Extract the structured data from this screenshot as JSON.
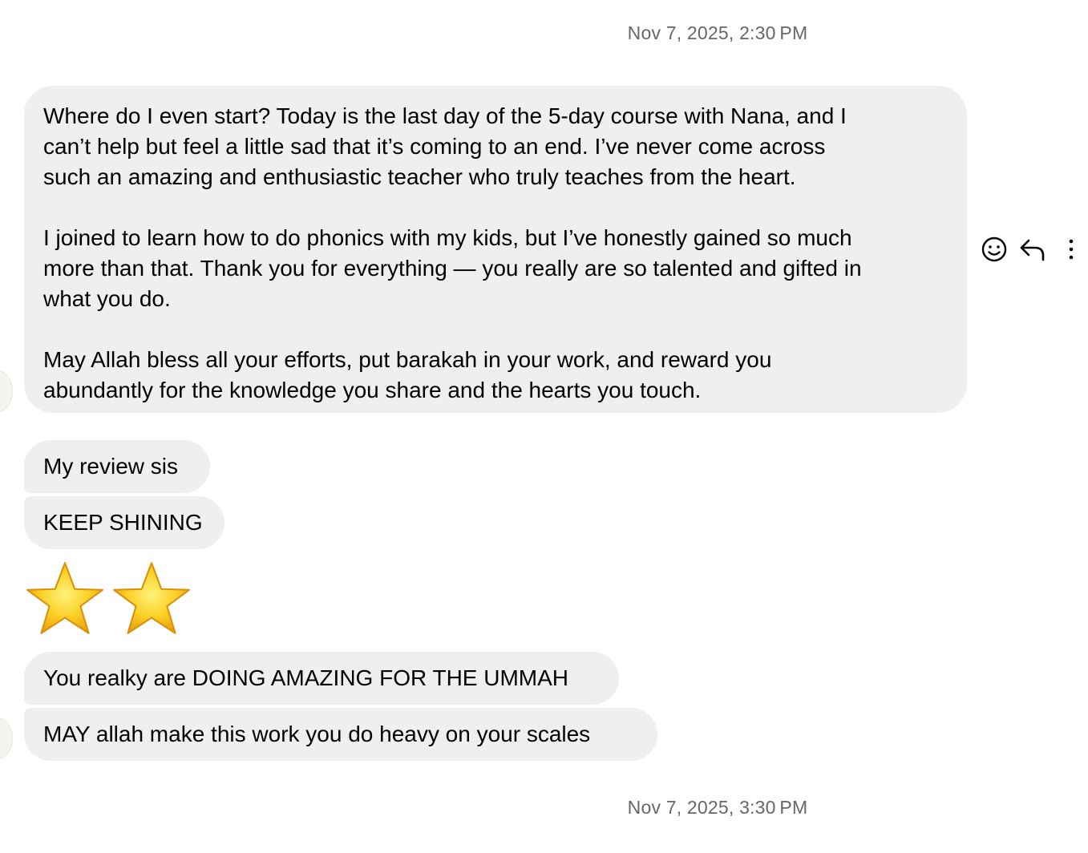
{
  "timestamps": {
    "top": "Nov 7, 2025, 2:30 PM",
    "bottom": "Nov 7, 2025, 3:30 PM"
  },
  "messages": {
    "long": {
      "p1_l1": "Where do I even start? Today is the last day of the 5-day course with Nana, and I",
      "p1_l2": "can’t help but feel a little sad that it’s coming to an end. I’ve never come across",
      "p1_l3": "such an amazing and enthusiastic teacher who truly teaches from the heart.",
      "p2_l1": "I joined to learn how to do phonics with my kids, but I’ve honestly gained so much",
      "p2_l2": "more than that. Thank you for everything — you really are so talented and gifted in",
      "p2_l3": "what you do.",
      "p3_l1": "May Allah bless all your efforts, put barakah in your work, and reward you",
      "p3_l2": "abundantly for the knowledge you share and the hearts you touch."
    },
    "review": "My review sis",
    "keep_shining": "KEEP SHINING",
    "stars": [
      "star-emoji",
      "star-emoji"
    ],
    "doing_amazing": "You realky are DOING AMAZING FOR THE UMMAH",
    "may_allah": "MAY allah make this work you do heavy on your scales"
  },
  "actions": {
    "icons": [
      "smiley-icon",
      "reply-icon",
      "more-vertical-icon"
    ]
  },
  "colors": {
    "bubble_bg": "#efefef",
    "timestamp_text": "#65676b",
    "star_fill": "#f7c21a"
  }
}
